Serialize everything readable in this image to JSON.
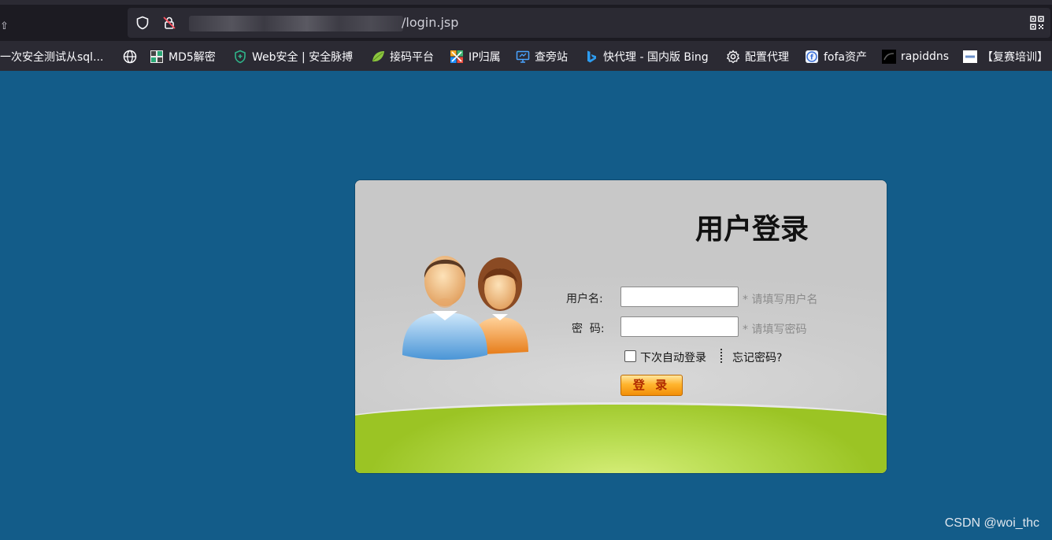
{
  "browser": {
    "tab_edge_glyph": "⇧",
    "url_path": "/login.jsp",
    "bookmarks": [
      {
        "label": "一次安全测试从sql...",
        "icon": "none"
      },
      {
        "label": "",
        "icon": "globe-icon"
      },
      {
        "label": "MD5解密",
        "icon": "cmd5-logo-icon"
      },
      {
        "label": "Web安全 | 安全脉搏",
        "icon": "shield-plus-icon"
      },
      {
        "label": "接码平台",
        "icon": "leaf-icon"
      },
      {
        "label": "IP归属",
        "icon": "ip-grid-icon"
      },
      {
        "label": "查旁站",
        "icon": "monitor-icon"
      },
      {
        "label": "快代理 - 国内版 Bing",
        "icon": "bing-icon"
      },
      {
        "label": "配置代理",
        "icon": "gear-icon"
      },
      {
        "label": "fofa资产",
        "icon": "fofa-icon"
      },
      {
        "label": "rapiddns",
        "icon": "rapiddns-icon"
      },
      {
        "label": "【复赛培训】",
        "icon": "cisp-icon"
      }
    ]
  },
  "login": {
    "title": "用户登录",
    "username_label": "用户名:",
    "username_value": "",
    "username_hint": "* 请填写用户名",
    "password_label": "密  码:",
    "password_value": "",
    "password_hint": "* 请填写密码",
    "remember_label": "下次自动登录",
    "forgot_label": "忘记密码?",
    "submit_label": "登 录"
  },
  "watermark": "CSDN @woi_thc",
  "colors": {
    "page_bg": "#135c89",
    "panel_gray": "#c9c9c9",
    "panel_green": "#9bc424",
    "button_orange": "#ffb52e"
  }
}
